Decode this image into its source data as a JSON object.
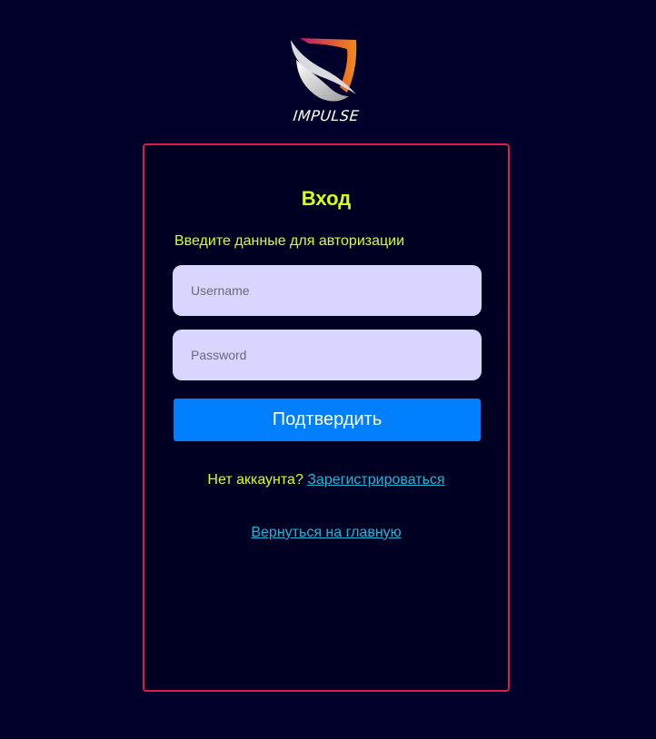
{
  "brand": {
    "name": "IMPULSE",
    "logo_icon": "shield-logo-icon",
    "colors": {
      "gradient_start": "#c0186a",
      "gradient_end": "#f28a1a",
      "shield_light": "#f2f2f2",
      "shield_shadow": "#9a9a9a"
    }
  },
  "colors": {
    "page_background": "#00002b",
    "card_background": "#000022",
    "card_border": "#e0194f",
    "accent_text": "#d7ff0f",
    "input_background": "#d8d6fe",
    "button_background": "#007fff",
    "link": "#1bb7d6"
  },
  "login": {
    "title": "Вход",
    "subtitle": "Введите данные для авторизации",
    "username_placeholder": "Username",
    "username_value": "",
    "password_placeholder": "Password",
    "password_value": "",
    "submit_label": "Подтвердить",
    "no_account_text": "Нет аккаунта?",
    "register_link": "Зарегистрироваться",
    "back_link": "Вернуться на главную"
  }
}
